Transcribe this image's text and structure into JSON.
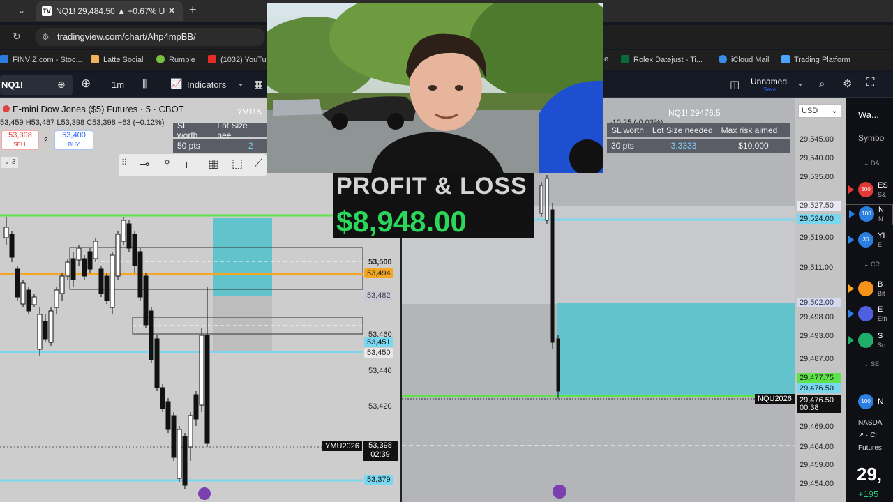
{
  "browser": {
    "tab_title": "NQ1! 29,484.50 ▲ +0.67% U",
    "url": "tradingview.com/chart/Ahp4mpBB/",
    "bookmarks": [
      "FINVIZ.com - Stoc...",
      "Latte Social",
      "Rumble",
      "(1032) YouTu...",
      "e",
      "Rolex Datejust - Ti...",
      "iCloud Mail",
      "Trading Platform"
    ]
  },
  "toolbar": {
    "symbol": "NQ1!",
    "interval": "1m",
    "indicators": "Indicators",
    "layout_name": "Unnamed",
    "layout_sub": "Save"
  },
  "left_chart": {
    "title": "E-mini Dow Jones ($5) Futures · 5 · CBOT",
    "ohlc": "53,459 H53,487 L53,398 C53,398 −63 (−0.12%)",
    "sell_price": "53,398",
    "sell_label": "SELL",
    "spread": "2",
    "buy_price": "53,400",
    "buy_label": "BUY",
    "badge": "3",
    "tag_ym": "YM1! 5",
    "sl_header": "SL worth",
    "lot_header": "Lot Size nee",
    "sl_value": "50 pts",
    "lot_value": "2",
    "prices": [
      "53,500",
      "53,494",
      "53,482",
      "53,460",
      "53,451",
      "53,450",
      "53,440",
      "53,420",
      "53,398",
      "02:39",
      "53,379"
    ],
    "contract": "YMU2026"
  },
  "right_chart": {
    "title": "NQ1! 29476.5",
    "change": "-10.25 (-0.03%)",
    "currency": "USD",
    "sl_header": "SL worth",
    "lot_header": "Lot Size needed",
    "risk_header": "Max risk aimed",
    "sl_value": "30 pts",
    "lot_value": "3.3333",
    "risk_value": "$10,000",
    "axis": [
      "29,545.00",
      "29,540.00",
      "29,535.00",
      "29,527.50",
      "29,524.00",
      "29,519.00",
      "29,511.00",
      "29,502.00",
      "29,498.00",
      "29,493.00",
      "29,487.00",
      "29,477.75",
      "29,476.50",
      "29,476.50",
      "00:38",
      "29,469.00",
      "29,464.00",
      "29,459.00",
      "29,454.00"
    ],
    "contract": "NQU2026"
  },
  "watchlist": {
    "header": "Wa...",
    "col": "Symbo",
    "items": [
      {
        "badge": "500",
        "t": "ES",
        "s": "S&"
      },
      {
        "badge": "100",
        "t": "N",
        "s": "N"
      },
      {
        "badge": "30",
        "t": "YI",
        "s": "E-"
      },
      {
        "badge": "",
        "t": "B",
        "s": "Bit"
      },
      {
        "badge": "",
        "t": "E",
        "s": "Eth"
      },
      {
        "badge": "",
        "t": "S",
        "s": "Sc"
      }
    ],
    "sec1": "DA",
    "sec2": "CR",
    "sec3": "SE",
    "detail_badge": "100",
    "detail_sym": "N",
    "detail_exch": "NASDA",
    "detail_cl": "Cl",
    "detail_type": "Futures",
    "detail_price": "29,",
    "detail_change": "+195"
  },
  "overlay": {
    "pl_title": "PROFIT & LOSS",
    "pl_value": "$8,948.00"
  },
  "colors": {
    "green": "#5ee34a",
    "cyan": "#79d8f0",
    "orange": "#f5a623",
    "teal": "#62c3cc"
  }
}
